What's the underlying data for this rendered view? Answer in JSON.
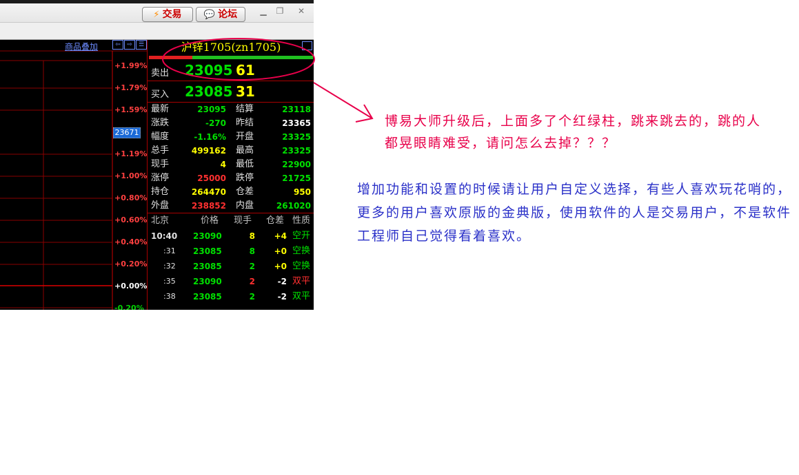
{
  "titlebar": {
    "trade_button": "交易",
    "forum_button": "论坛",
    "trade_icon": "lightning-icon",
    "forum_icon": "speech-bubble-icon"
  },
  "chart": {
    "overlay_link": "商品叠加",
    "percent_labels": [
      "+1.99%",
      "+1.79%",
      "+1.59%",
      "+1.19%",
      "+1.00%",
      "+0.80%",
      "+0.60%",
      "+0.40%",
      "+0.20%",
      "+0.00%",
      "-0.20%"
    ],
    "current_price_tag": "23671"
  },
  "quote": {
    "title": "沪锌1705(zn1705)",
    "sell_label": "卖出",
    "sell_price": "23095",
    "sell_volume": "61",
    "buy_label": "买入",
    "buy_price": "23085",
    "buy_volume": "31",
    "rows": [
      {
        "l1": "最新",
        "v1": "23095",
        "l2": "结算",
        "v2": "23118"
      },
      {
        "l1": "涨跌",
        "v1": "-270",
        "l2": "昨结",
        "v2": "23365"
      },
      {
        "l1": "幅度",
        "v1": "-1.16%",
        "l2": "开盘",
        "v2": "23325"
      },
      {
        "l1": "总手",
        "v1": "499162",
        "l2": "最高",
        "v2": "23325"
      },
      {
        "l1": "现手",
        "v1": "4",
        "l2": "最低",
        "v2": "22900"
      },
      {
        "l1": "涨停",
        "v1": "25000",
        "l2": "跌停",
        "v2": "21725"
      },
      {
        "l1": "持仓",
        "v1": "264470",
        "l2": "仓差",
        "v2": "950"
      },
      {
        "l1": "外盘",
        "v1": "238852",
        "l2": "内盘",
        "v2": "261020"
      }
    ],
    "colors": {
      "up": "#ff3030",
      "down": "#00e000",
      "neutral": "#ffffff",
      "volume": "#ffff00"
    }
  },
  "ticks": {
    "headers": [
      "北京",
      "价格",
      "现手",
      "仓差",
      "性质"
    ],
    "rows": [
      {
        "time": "10:40",
        "price": "23090",
        "vol": "8",
        "oi": "+4",
        "nature": "空开"
      },
      {
        "time": ":31",
        "price": "23085",
        "vol": "8",
        "oi": "+0",
        "nature": "空换"
      },
      {
        "time": ":32",
        "price": "23085",
        "vol": "2",
        "oi": "+0",
        "nature": "空换"
      },
      {
        "time": ":35",
        "price": "23090",
        "vol": "2",
        "oi": "-2",
        "nature": "双平"
      },
      {
        "time": ":38",
        "price": "23085",
        "vol": "2",
        "oi": "-2",
        "nature": "双平"
      }
    ]
  },
  "annotations": {
    "complaint": "博易大师升级后，上面多了个红绿柱，跳来跳去的，跳的人都晃眼睛难受，请问怎么去掉？？？",
    "suggestion": "增加功能和设置的时候请让用户自定义选择，有些人喜欢玩花哨的，更多的用户喜欢原版的金典版，使用软件的人是交易用户，不是软件工程师自己觉得看着喜欢。",
    "complaint_color": "#e8004a",
    "suggestion_color": "#2a30c8"
  }
}
